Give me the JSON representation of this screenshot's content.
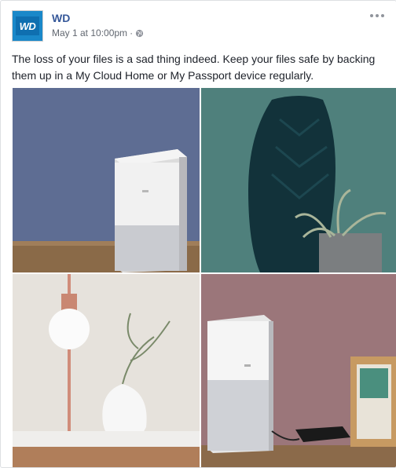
{
  "post": {
    "author": "WD",
    "logo_text": "WD",
    "timestamp": "May 1 at 10:00pm",
    "separator": "·",
    "privacy_icon": "globe-icon",
    "more_icon": "more-options-icon",
    "message": "The loss of your files is a sad thing indeed. Keep your files safe by backing them up in a My Cloud Home or My Passport device regularly."
  },
  "photos": [
    {
      "subject": "My Cloud Home on wooden shelf, blue wall"
    },
    {
      "subject": "dark teal patterned vase with air plant"
    },
    {
      "subject": "pendant bulb lamp and white vase with branch on marble table"
    },
    {
      "subject": "My Cloud Home with My Passport drive and framed photo, mauve wall"
    }
  ],
  "colors": {
    "author_link": "#365899",
    "meta_text": "#616770",
    "brand_blue": "#1a88c9"
  }
}
